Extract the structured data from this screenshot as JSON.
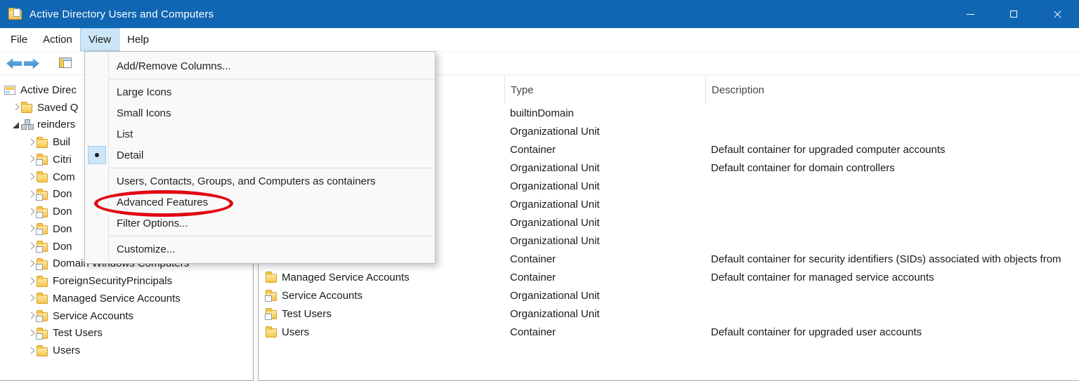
{
  "window": {
    "title": "Active Directory Users and Computers"
  },
  "colors": {
    "titlebar": "#1066b2",
    "menu_highlight": "#cde6f7",
    "annotation": "#e20613"
  },
  "menubar": {
    "file": "File",
    "action": "Action",
    "view": "View",
    "help": "Help"
  },
  "view_menu": {
    "add_remove_columns": "Add/Remove Columns...",
    "large_icons": "Large Icons",
    "small_icons": "Small Icons",
    "list": "List",
    "detail": "Detail",
    "containers_toggle": "Users, Contacts, Groups, and Computers as containers",
    "advanced_features": "Advanced Features",
    "filter_options": "Filter Options...",
    "customize": "Customize..."
  },
  "tree": {
    "items": [
      {
        "label": "Active Direc"
      },
      {
        "label": "Saved Q"
      },
      {
        "label": "reinders"
      },
      {
        "label": "Buil"
      },
      {
        "label": "Citri"
      },
      {
        "label": "Com"
      },
      {
        "label": "Don"
      },
      {
        "label": "Don"
      },
      {
        "label": "Don"
      },
      {
        "label": "Don"
      },
      {
        "label": "Domain Windows Computers"
      },
      {
        "label": "ForeignSecurityPrincipals"
      },
      {
        "label": "Managed Service Accounts"
      },
      {
        "label": "Service Accounts"
      },
      {
        "label": "Test Users"
      },
      {
        "label": "Users"
      }
    ]
  },
  "list": {
    "columns": {
      "name": "",
      "type": "Type",
      "description": "Description"
    },
    "rows": [
      {
        "name": "",
        "type": "builtinDomain",
        "description": ""
      },
      {
        "name": "",
        "type": "Organizational Unit",
        "description": ""
      },
      {
        "name": "",
        "type": "Container",
        "description": "Default container for upgraded computer accounts"
      },
      {
        "name": "",
        "type": "Organizational Unit",
        "description": "Default container for domain controllers"
      },
      {
        "name": "",
        "type": "Organizational Unit",
        "description": ""
      },
      {
        "name": "",
        "type": "Organizational Unit",
        "description": ""
      },
      {
        "name": "",
        "type": "Organizational Unit",
        "description": ""
      },
      {
        "name": "",
        "type": "Organizational Unit",
        "description": ""
      },
      {
        "name": "",
        "type": "Container",
        "description": "Default container for security identifiers (SIDs) associated with objects from"
      },
      {
        "name": "Managed Service Accounts",
        "type": "Container",
        "description": "Default container for managed service accounts"
      },
      {
        "name": "Service Accounts",
        "type": "Organizational Unit",
        "description": ""
      },
      {
        "name": "Test Users",
        "type": "Organizational Unit",
        "description": ""
      },
      {
        "name": "Users",
        "type": "Container",
        "description": "Default container for upgraded user accounts"
      }
    ]
  }
}
